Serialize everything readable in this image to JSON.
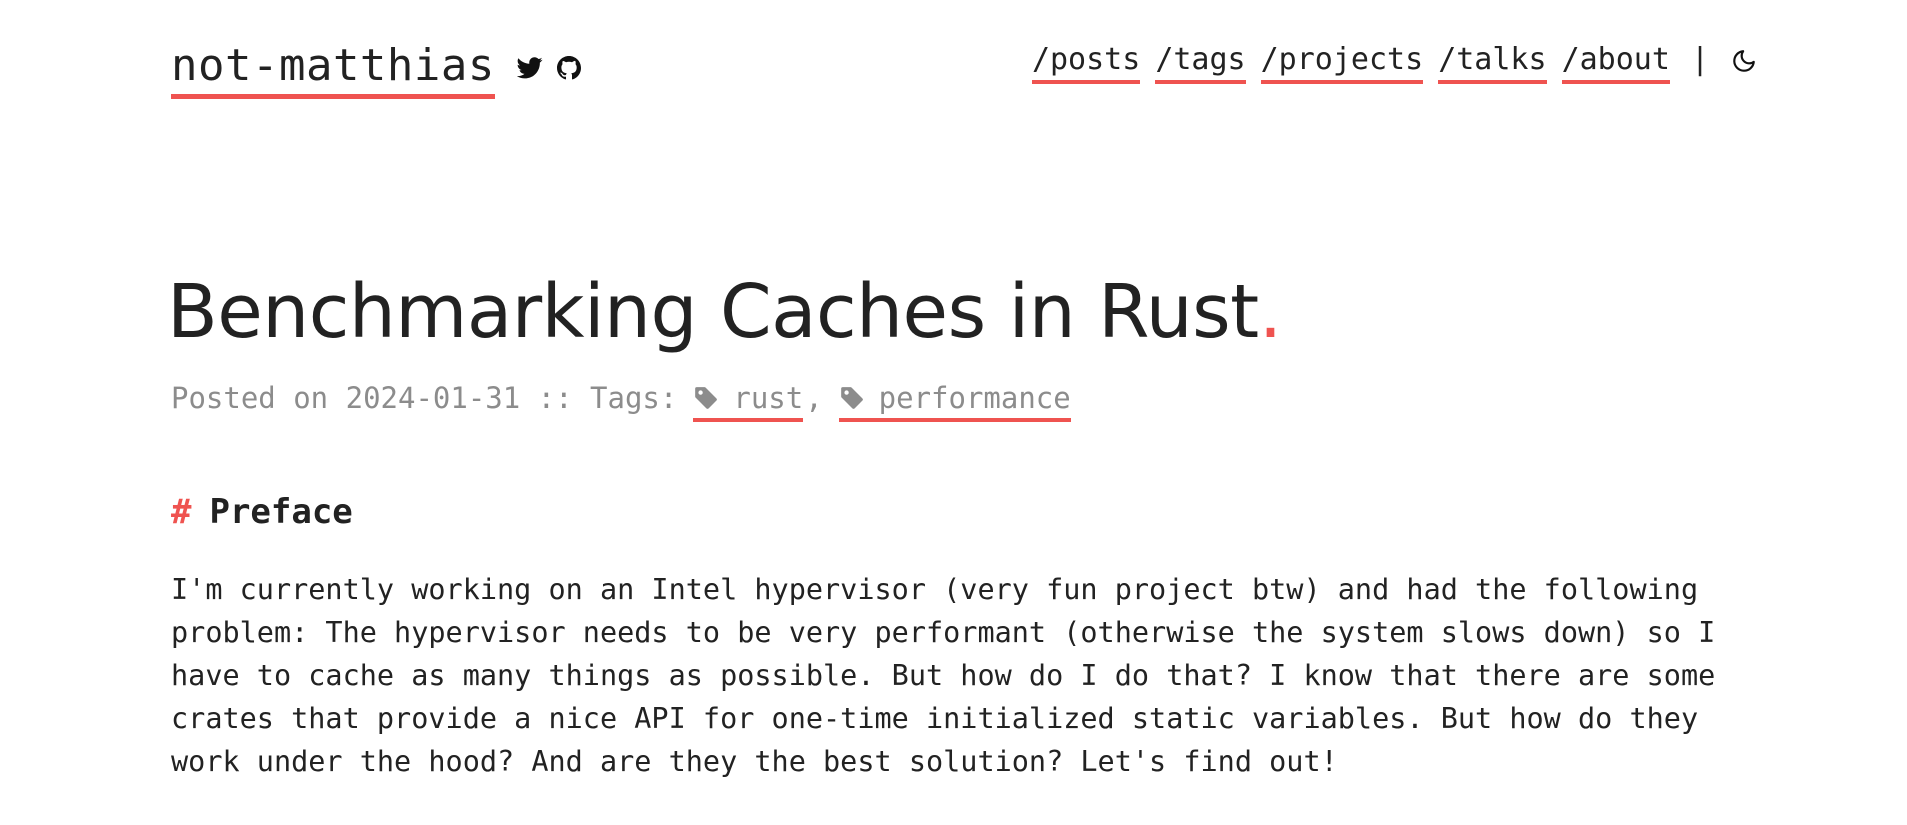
{
  "site": {
    "title": "not-matthias",
    "social": [
      {
        "icon": "twitter-icon"
      },
      {
        "icon": "github-icon"
      }
    ]
  },
  "nav": {
    "items": [
      "/posts",
      "/tags",
      "/projects",
      "/talks",
      "/about"
    ],
    "separator": "|",
    "theme_toggle_icon": "moon-icon"
  },
  "post": {
    "title": "Benchmarking Caches in Rust",
    "title_dot": ".",
    "meta": {
      "posted_prefix": "Posted on ",
      "date": "2024-01-31",
      "tags_label": " :: Tags:",
      "tags": [
        "rust",
        "performance"
      ],
      "tag_separator": ","
    },
    "section": {
      "hash": "#",
      "heading": "Preface"
    },
    "paragraph_lines": [
      "I'm currently working on an Intel hypervisor (very fun project btw) and had the following",
      "problem: The hypervisor needs to be very performant (otherwise the system slows down) so I",
      "have to cache as many things as possible. But how do I do that? I know that there are some",
      "crates that provide a nice API for one-time initialized static variables. But how do they",
      "work under the hood? And are they the best solution? Let's find out!"
    ]
  },
  "colors": {
    "accent": "#ef5350",
    "text": "#222222",
    "muted": "#8c8c8c",
    "background": "#ffffff"
  }
}
